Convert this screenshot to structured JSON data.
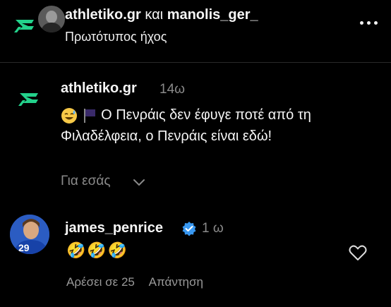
{
  "header": {
    "user_a": "athletiko.gr",
    "conjunction": "και",
    "user_b": "manolis_ger_",
    "subtitle": "Πρωτότυπος ήχος"
  },
  "post": {
    "username": "athletiko.gr",
    "time": "14ω",
    "text": "Ο Πενράις δεν έφυγε ποτέ από τη Φιλαδέλφεια, ο Πενράις είναι εδώ!",
    "emojis": [
      "smiling-face-with-sweat-emoji",
      "black-flag-emoji"
    ],
    "for_you_label": "Για εσάς"
  },
  "comment": {
    "username": "james_penrice",
    "verified": true,
    "time": "1 ω",
    "emoji_text": "🤣🤣🤣",
    "likes_label": "Αρέσει σε 25",
    "reply_label": "Απάντηση",
    "jersey_number": "29"
  },
  "colors": {
    "background": "#000000",
    "brand_green": "#23d18b",
    "verified_blue": "#3897f0",
    "muted_text": "#8a8a8a"
  },
  "icons": [
    "more-icon",
    "chevron-down-icon",
    "verified-icon",
    "heart-icon",
    "athletiko-logo-icon"
  ]
}
